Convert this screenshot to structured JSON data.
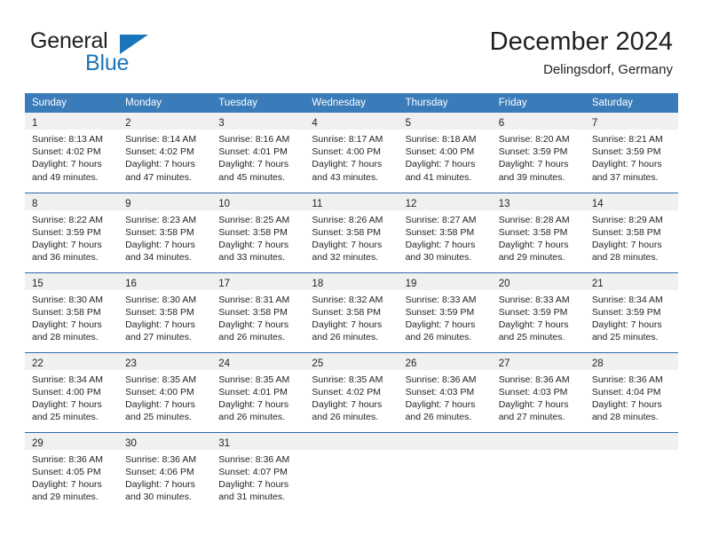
{
  "brand": {
    "name_part1": "General",
    "name_part2": "Blue",
    "triangle_icon": "brand-triangle-icon",
    "accent_color": "#1b75bb"
  },
  "header": {
    "month_title": "December 2024",
    "location": "Delingsdorf, Germany"
  },
  "theme": {
    "header_row_bg": "#3a7cba",
    "row_divider": "#2c6ca8",
    "daynum_band_bg": "#f0f0f0",
    "text_color": "#231f20"
  },
  "calendar": {
    "weekday_headers": [
      "Sunday",
      "Monday",
      "Tuesday",
      "Wednesday",
      "Thursday",
      "Friday",
      "Saturday"
    ],
    "weeks": [
      [
        {
          "day": "1",
          "sunrise": "Sunrise: 8:13 AM",
          "sunset": "Sunset: 4:02 PM",
          "daylight_line1": "Daylight: 7 hours",
          "daylight_line2": "and 49 minutes."
        },
        {
          "day": "2",
          "sunrise": "Sunrise: 8:14 AM",
          "sunset": "Sunset: 4:02 PM",
          "daylight_line1": "Daylight: 7 hours",
          "daylight_line2": "and 47 minutes."
        },
        {
          "day": "3",
          "sunrise": "Sunrise: 8:16 AM",
          "sunset": "Sunset: 4:01 PM",
          "daylight_line1": "Daylight: 7 hours",
          "daylight_line2": "and 45 minutes."
        },
        {
          "day": "4",
          "sunrise": "Sunrise: 8:17 AM",
          "sunset": "Sunset: 4:00 PM",
          "daylight_line1": "Daylight: 7 hours",
          "daylight_line2": "and 43 minutes."
        },
        {
          "day": "5",
          "sunrise": "Sunrise: 8:18 AM",
          "sunset": "Sunset: 4:00 PM",
          "daylight_line1": "Daylight: 7 hours",
          "daylight_line2": "and 41 minutes."
        },
        {
          "day": "6",
          "sunrise": "Sunrise: 8:20 AM",
          "sunset": "Sunset: 3:59 PM",
          "daylight_line1": "Daylight: 7 hours",
          "daylight_line2": "and 39 minutes."
        },
        {
          "day": "7",
          "sunrise": "Sunrise: 8:21 AM",
          "sunset": "Sunset: 3:59 PM",
          "daylight_line1": "Daylight: 7 hours",
          "daylight_line2": "and 37 minutes."
        }
      ],
      [
        {
          "day": "8",
          "sunrise": "Sunrise: 8:22 AM",
          "sunset": "Sunset: 3:59 PM",
          "daylight_line1": "Daylight: 7 hours",
          "daylight_line2": "and 36 minutes."
        },
        {
          "day": "9",
          "sunrise": "Sunrise: 8:23 AM",
          "sunset": "Sunset: 3:58 PM",
          "daylight_line1": "Daylight: 7 hours",
          "daylight_line2": "and 34 minutes."
        },
        {
          "day": "10",
          "sunrise": "Sunrise: 8:25 AM",
          "sunset": "Sunset: 3:58 PM",
          "daylight_line1": "Daylight: 7 hours",
          "daylight_line2": "and 33 minutes."
        },
        {
          "day": "11",
          "sunrise": "Sunrise: 8:26 AM",
          "sunset": "Sunset: 3:58 PM",
          "daylight_line1": "Daylight: 7 hours",
          "daylight_line2": "and 32 minutes."
        },
        {
          "day": "12",
          "sunrise": "Sunrise: 8:27 AM",
          "sunset": "Sunset: 3:58 PM",
          "daylight_line1": "Daylight: 7 hours",
          "daylight_line2": "and 30 minutes."
        },
        {
          "day": "13",
          "sunrise": "Sunrise: 8:28 AM",
          "sunset": "Sunset: 3:58 PM",
          "daylight_line1": "Daylight: 7 hours",
          "daylight_line2": "and 29 minutes."
        },
        {
          "day": "14",
          "sunrise": "Sunrise: 8:29 AM",
          "sunset": "Sunset: 3:58 PM",
          "daylight_line1": "Daylight: 7 hours",
          "daylight_line2": "and 28 minutes."
        }
      ],
      [
        {
          "day": "15",
          "sunrise": "Sunrise: 8:30 AM",
          "sunset": "Sunset: 3:58 PM",
          "daylight_line1": "Daylight: 7 hours",
          "daylight_line2": "and 28 minutes."
        },
        {
          "day": "16",
          "sunrise": "Sunrise: 8:30 AM",
          "sunset": "Sunset: 3:58 PM",
          "daylight_line1": "Daylight: 7 hours",
          "daylight_line2": "and 27 minutes."
        },
        {
          "day": "17",
          "sunrise": "Sunrise: 8:31 AM",
          "sunset": "Sunset: 3:58 PM",
          "daylight_line1": "Daylight: 7 hours",
          "daylight_line2": "and 26 minutes."
        },
        {
          "day": "18",
          "sunrise": "Sunrise: 8:32 AM",
          "sunset": "Sunset: 3:58 PM",
          "daylight_line1": "Daylight: 7 hours",
          "daylight_line2": "and 26 minutes."
        },
        {
          "day": "19",
          "sunrise": "Sunrise: 8:33 AM",
          "sunset": "Sunset: 3:59 PM",
          "daylight_line1": "Daylight: 7 hours",
          "daylight_line2": "and 26 minutes."
        },
        {
          "day": "20",
          "sunrise": "Sunrise: 8:33 AM",
          "sunset": "Sunset: 3:59 PM",
          "daylight_line1": "Daylight: 7 hours",
          "daylight_line2": "and 25 minutes."
        },
        {
          "day": "21",
          "sunrise": "Sunrise: 8:34 AM",
          "sunset": "Sunset: 3:59 PM",
          "daylight_line1": "Daylight: 7 hours",
          "daylight_line2": "and 25 minutes."
        }
      ],
      [
        {
          "day": "22",
          "sunrise": "Sunrise: 8:34 AM",
          "sunset": "Sunset: 4:00 PM",
          "daylight_line1": "Daylight: 7 hours",
          "daylight_line2": "and 25 minutes."
        },
        {
          "day": "23",
          "sunrise": "Sunrise: 8:35 AM",
          "sunset": "Sunset: 4:00 PM",
          "daylight_line1": "Daylight: 7 hours",
          "daylight_line2": "and 25 minutes."
        },
        {
          "day": "24",
          "sunrise": "Sunrise: 8:35 AM",
          "sunset": "Sunset: 4:01 PM",
          "daylight_line1": "Daylight: 7 hours",
          "daylight_line2": "and 26 minutes."
        },
        {
          "day": "25",
          "sunrise": "Sunrise: 8:35 AM",
          "sunset": "Sunset: 4:02 PM",
          "daylight_line1": "Daylight: 7 hours",
          "daylight_line2": "and 26 minutes."
        },
        {
          "day": "26",
          "sunrise": "Sunrise: 8:36 AM",
          "sunset": "Sunset: 4:03 PM",
          "daylight_line1": "Daylight: 7 hours",
          "daylight_line2": "and 26 minutes."
        },
        {
          "day": "27",
          "sunrise": "Sunrise: 8:36 AM",
          "sunset": "Sunset: 4:03 PM",
          "daylight_line1": "Daylight: 7 hours",
          "daylight_line2": "and 27 minutes."
        },
        {
          "day": "28",
          "sunrise": "Sunrise: 8:36 AM",
          "sunset": "Sunset: 4:04 PM",
          "daylight_line1": "Daylight: 7 hours",
          "daylight_line2": "and 28 minutes."
        }
      ],
      [
        {
          "day": "29",
          "sunrise": "Sunrise: 8:36 AM",
          "sunset": "Sunset: 4:05 PM",
          "daylight_line1": "Daylight: 7 hours",
          "daylight_line2": "and 29 minutes."
        },
        {
          "day": "30",
          "sunrise": "Sunrise: 8:36 AM",
          "sunset": "Sunset: 4:06 PM",
          "daylight_line1": "Daylight: 7 hours",
          "daylight_line2": "and 30 minutes."
        },
        {
          "day": "31",
          "sunrise": "Sunrise: 8:36 AM",
          "sunset": "Sunset: 4:07 PM",
          "daylight_line1": "Daylight: 7 hours",
          "daylight_line2": "and 31 minutes."
        },
        {
          "day": "",
          "sunrise": "",
          "sunset": "",
          "daylight_line1": "",
          "daylight_line2": ""
        },
        {
          "day": "",
          "sunrise": "",
          "sunset": "",
          "daylight_line1": "",
          "daylight_line2": ""
        },
        {
          "day": "",
          "sunrise": "",
          "sunset": "",
          "daylight_line1": "",
          "daylight_line2": ""
        },
        {
          "day": "",
          "sunrise": "",
          "sunset": "",
          "daylight_line1": "",
          "daylight_line2": ""
        }
      ]
    ]
  }
}
